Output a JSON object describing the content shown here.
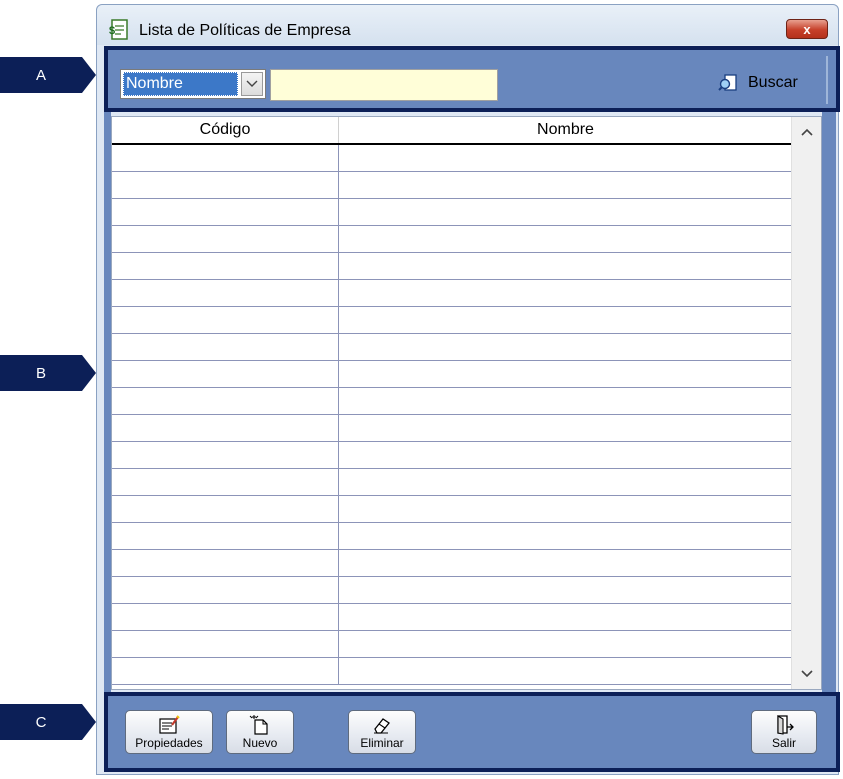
{
  "window": {
    "title": "Lista de Políticas de Empresa",
    "close_label": "x"
  },
  "callouts": [
    "A",
    "B",
    "C"
  ],
  "search": {
    "field_selected": "Nombre",
    "value": "",
    "placeholder": "",
    "buscar_label": "Buscar"
  },
  "grid": {
    "columns": [
      "Código",
      "Nombre"
    ],
    "rows": []
  },
  "toolbar": {
    "propiedades_label": "Propiedades",
    "nuevo_label": "Nuevo",
    "eliminar_label": "Eliminar",
    "salir_label": "Salir"
  },
  "colors": {
    "accent_dark": "#0c1f57",
    "panel_blue": "#6887bd",
    "input_yellow": "#fffed8",
    "selection_blue": "#3c78c8"
  },
  "icons": {
    "title": "document-icon",
    "buscar": "magnifier-icon",
    "propiedades": "properties-icon",
    "nuevo": "new-document-icon",
    "eliminar": "eraser-icon",
    "salir": "exit-door-icon"
  }
}
